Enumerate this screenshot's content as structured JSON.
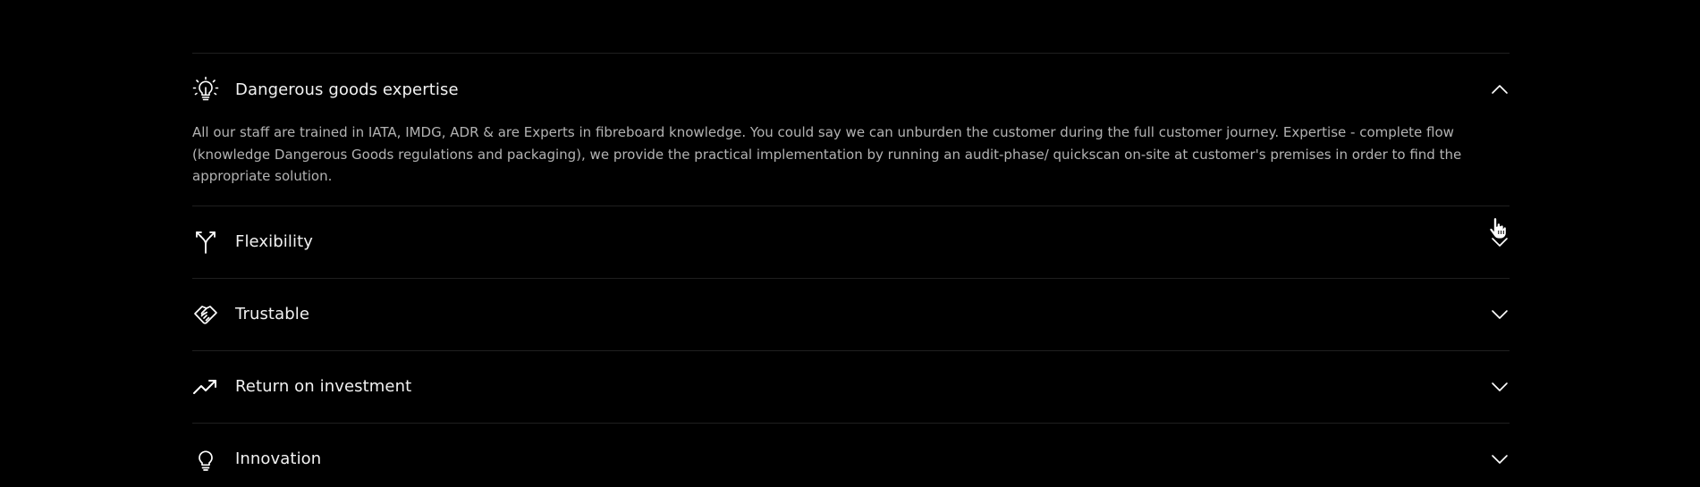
{
  "accordion": {
    "items": [
      {
        "title": "Dangerous goods expertise",
        "icon": "lightbulb-rays-icon",
        "expanded": true,
        "body": "All our staff are trained in IATA, IMDG, ADR & are Experts in fibreboard knowledge. You could say we can unburden the customer during the full customer journey. Expertise - complete flow (knowledge Dangerous Goods regulations and packaging), we provide the practical implementation by running an audit-phase/ quickscan on-site at customer's premises in order to find the appropriate solution."
      },
      {
        "title": "Flexibility",
        "icon": "split-arrows-icon",
        "expanded": false
      },
      {
        "title": "Trustable",
        "icon": "handshake-icon",
        "expanded": false
      },
      {
        "title": "Return on investment",
        "icon": "trending-up-icon",
        "expanded": false
      },
      {
        "title": "Innovation",
        "icon": "lightbulb-icon",
        "expanded": false
      }
    ]
  },
  "colors": {
    "background": "#000000",
    "title": "#f2f2f2",
    "body_text": "#b3b3b3",
    "divider": "#1f1f1f"
  }
}
